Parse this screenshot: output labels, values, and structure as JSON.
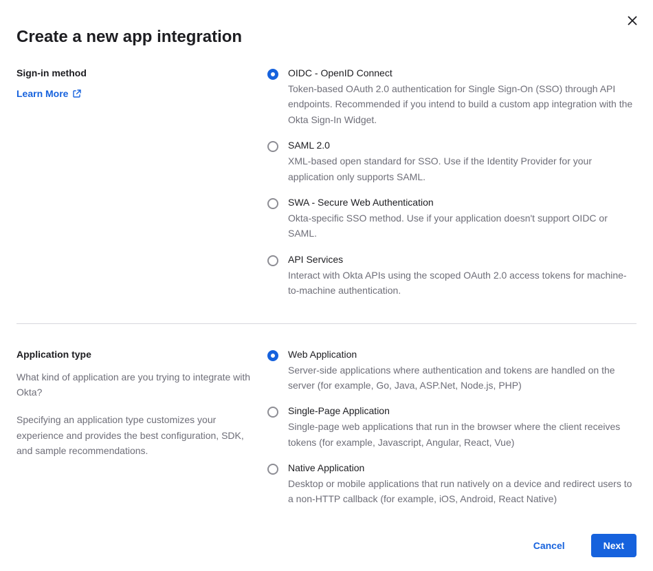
{
  "modal": {
    "title": "Create a new app integration",
    "close_label": "Close"
  },
  "sections": {
    "signin": {
      "label": "Sign-in method",
      "learn_more": "Learn More",
      "options": [
        {
          "title": "OIDC - OpenID Connect",
          "desc": "Token-based OAuth 2.0 authentication for Single Sign-On (SSO) through API endpoints. Recommended if you intend to build a custom app integration with the Okta Sign-In Widget.",
          "selected": true
        },
        {
          "title": "SAML 2.0",
          "desc": "XML-based open standard for SSO. Use if the Identity Provider for your application only supports SAML.",
          "selected": false
        },
        {
          "title": "SWA - Secure Web Authentication",
          "desc": "Okta-specific SSO method. Use if your application doesn't support OIDC or SAML.",
          "selected": false
        },
        {
          "title": "API Services",
          "desc": "Interact with Okta APIs using the scoped OAuth 2.0 access tokens for machine-to-machine authentication.",
          "selected": false
        }
      ]
    },
    "apptype": {
      "label": "Application type",
      "help1": "What kind of application are you trying to integrate with Okta?",
      "help2": "Specifying an application type customizes your experience and provides the best configuration, SDK, and sample recommendations.",
      "options": [
        {
          "title": "Web Application",
          "desc": "Server-side applications where authentication and tokens are handled on the server (for example, Go, Java, ASP.Net, Node.js, PHP)",
          "selected": true
        },
        {
          "title": "Single-Page Application",
          "desc": "Single-page web applications that run in the browser where the client receives tokens (for example, Javascript, Angular, React, Vue)",
          "selected": false
        },
        {
          "title": "Native Application",
          "desc": "Desktop or mobile applications that run natively on a device and redirect users to a non-HTTP callback (for example, iOS, Android, React Native)",
          "selected": false
        }
      ]
    }
  },
  "footer": {
    "cancel": "Cancel",
    "next": "Next"
  }
}
